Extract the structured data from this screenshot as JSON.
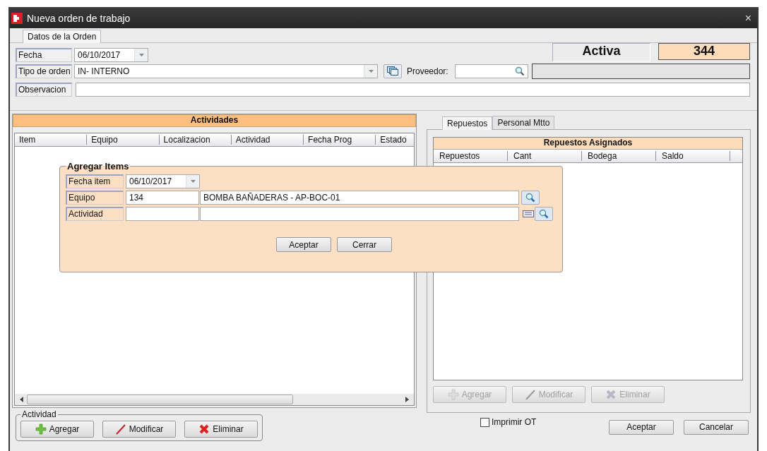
{
  "window": {
    "title": "Nueva orden de trabajo",
    "close": "×"
  },
  "tabs": [
    {
      "label": "Datos de la Orden",
      "selected": true
    }
  ],
  "form": {
    "fecha": {
      "label": "Fecha",
      "value": "06/10/2017"
    },
    "tipo": {
      "label": "Tipo de orden",
      "value": "IN- INTERNO"
    },
    "proveedor": {
      "label": "Proveedor:"
    },
    "observacion": {
      "label": "Observacion"
    }
  },
  "status": "Activa",
  "number": "344",
  "actividades": {
    "title": "Actividades",
    "columns": [
      "Item",
      "Equipo",
      "Localizacion",
      "Actividad",
      "Fecha Prog",
      "Estado"
    ]
  },
  "activity_group": {
    "legend": "Actividad",
    "buttons": [
      {
        "label": "Agregar",
        "kind": "add",
        "disabled": false
      },
      {
        "label": "Modificar",
        "kind": "edit",
        "disabled": false
      },
      {
        "label": "Eliminar",
        "kind": "delete",
        "disabled": false
      }
    ]
  },
  "right_tabs": [
    {
      "label": "Repuestos",
      "selected": true
    },
    {
      "label": "Personal Mtto",
      "selected": false
    }
  ],
  "repuestos": {
    "title": "Repuestos Asignados",
    "columns": [
      "Repuestos",
      "Cant",
      "Bodega",
      "Saldo"
    ],
    "buttons": [
      {
        "label": "Agregar",
        "kind": "add",
        "disabled": true
      },
      {
        "label": "Modificar",
        "kind": "edit",
        "disabled": true
      },
      {
        "label": "Eliminar",
        "kind": "delete",
        "disabled": true
      }
    ]
  },
  "print": {
    "label": "Imprimir OT",
    "checked": false
  },
  "footer_buttons": [
    "Aceptar",
    "Cancelar"
  ],
  "dialog": {
    "title": "Agregar Items",
    "fields": [
      {
        "kind": "date",
        "label": "Fecha item",
        "value": "06/10/2017"
      },
      {
        "kind": "lookup",
        "label": "Equipo",
        "code": "134",
        "description": "BOMBA BAÑADERAS - AP-BOC-01"
      },
      {
        "kind": "lookup-list",
        "label": "Actividad"
      }
    ],
    "buttons": [
      "Aceptar",
      "Cerrar"
    ]
  }
}
